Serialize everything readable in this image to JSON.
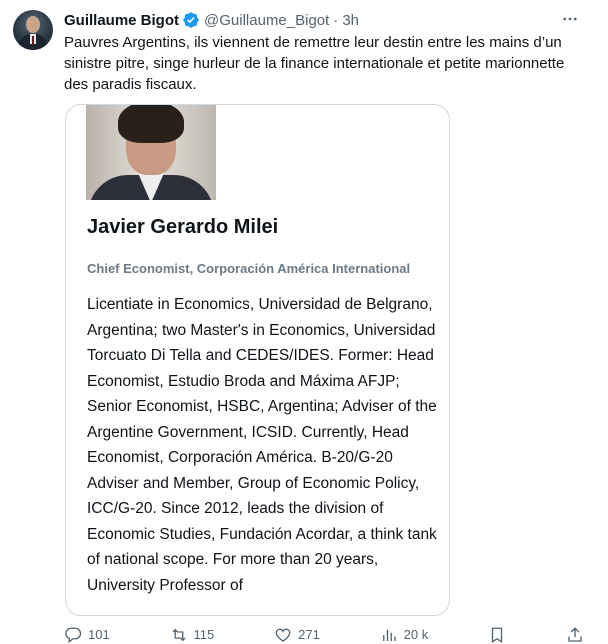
{
  "author": {
    "name": "Guillaume Bigot",
    "handle": "@Guillaume_Bigot",
    "separator": "·",
    "time": "3h"
  },
  "tweet": {
    "text": "Pauvres Argentins, ils viennent de remettre leur destin entre les mains d’un sinistre pitre, singe hurleur de la finance internationale et petite marionnette des paradis fiscaux."
  },
  "card": {
    "name": "Javier Gerardo Milei",
    "role": "Chief Economist, Corporación América International",
    "bio": "Licentiate in Economics, Universidad de Belgrano, Argentina; two Master's in Economics, Universidad Torcuato Di Tella and CEDES/IDES. Former: Head Economist, Estudio Broda and Máxima AFJP; Senior Economist, HSBC, Argentina; Adviser of the Argentine Government, ICSID. Currently, Head Economist, Corporación América. B-20/G-20 Adviser and Member, Group of Economic Policy, ICC/G-20. Since 2012, leads the division of Economic Studies, Fundación Acordar, a think tank of national scope. For more than 20 years, University Professor of"
  },
  "actions": {
    "replies": "101",
    "reposts": "115",
    "likes": "271",
    "views": "20 k"
  },
  "icons": {
    "verified": "verified-badge-icon",
    "more": "more-icon",
    "reply": "reply-icon",
    "repost": "repost-icon",
    "like": "like-icon",
    "views": "views-icon",
    "bookmark": "bookmark-icon",
    "share": "share-icon"
  },
  "colors": {
    "verified": "#1d9bf0",
    "text": "#0f1419",
    "secondary": "#536471",
    "border": "#cfd9de"
  }
}
